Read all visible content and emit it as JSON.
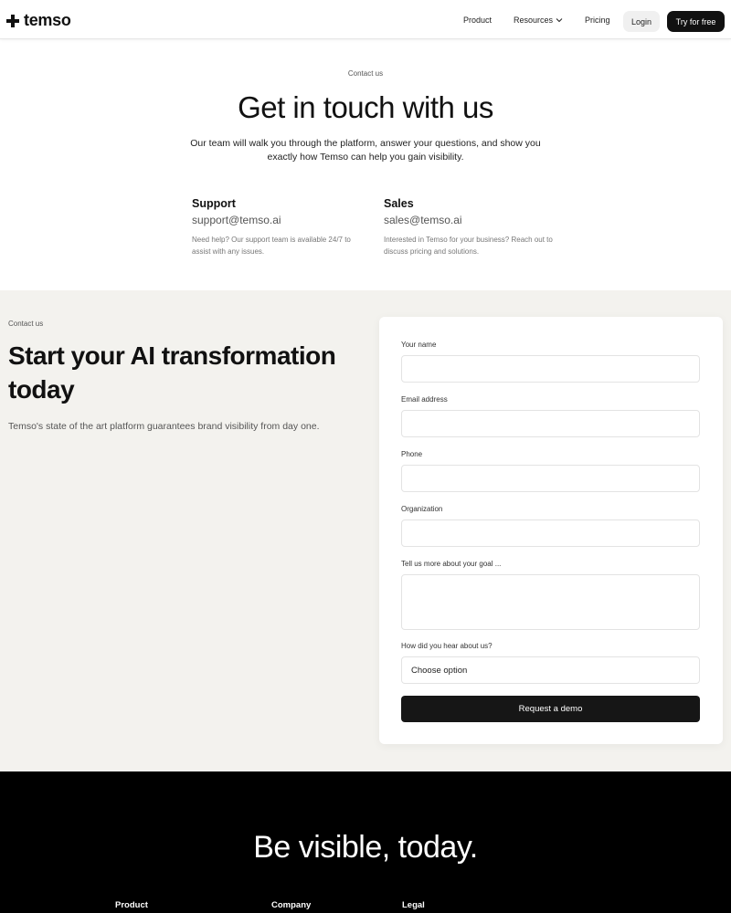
{
  "header": {
    "logo_text": "temso",
    "nav": {
      "product": "Product",
      "resources": "Resources",
      "pricing": "Pricing"
    },
    "login_label": "Login",
    "try_label": "Try for free"
  },
  "hero": {
    "eyebrow": "Contact us",
    "title": "Get in touch with us",
    "subtitle": "Our team will walk you through the platform, answer your questions, and show you exactly how Temso can help you gain visibility.",
    "support": {
      "heading": "Support",
      "email": "support@temso.ai",
      "description": "Need help? Our support team is available 24/7 to assist with any issues."
    },
    "sales": {
      "heading": "Sales",
      "email": "sales@temso.ai",
      "description": "Interested in Temso for your business? Reach out to discuss pricing and solutions."
    }
  },
  "form_section": {
    "eyebrow": "Contact us",
    "title": "Start your AI transformation today",
    "subtitle": "Temso's state of the art platform guarantees brand visibility from day one.",
    "form": {
      "name_label": "Your name",
      "email_label": "Email address",
      "phone_label": "Phone",
      "organization_label": "Organization",
      "goal_label": "Tell us more about your goal ...",
      "source_label": "How did you hear about us?",
      "source_selected": "Choose option",
      "submit_label": "Request a demo"
    }
  },
  "footer": {
    "title": "Be visible, today.",
    "columns": [
      "Product",
      "Company",
      "Legal"
    ]
  },
  "colors": {
    "accent": "#111111",
    "section_bg": "#f3f2ee",
    "footer_bg": "#000000"
  }
}
